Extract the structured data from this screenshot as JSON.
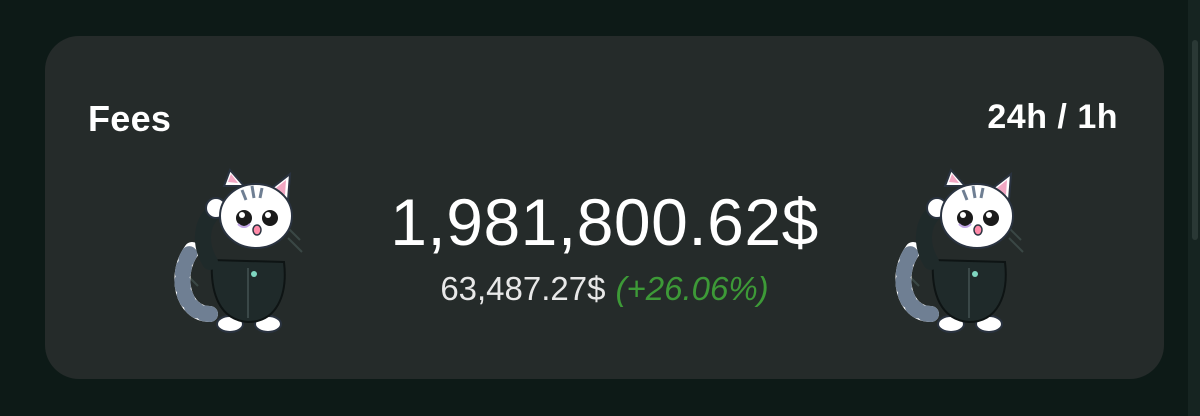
{
  "card": {
    "title": "Fees",
    "range_label": "24h / 1h",
    "main_value": "1,981,800.62$",
    "sub_value": "63,487.27$",
    "sub_change": "(+26.06%)"
  },
  "colors": {
    "background": "#0d1a17",
    "card": "#252b2a",
    "positive_change": "#3d9a37",
    "text": "#ffffff"
  },
  "icons": {
    "mascot": "cat-mascot-icon"
  }
}
